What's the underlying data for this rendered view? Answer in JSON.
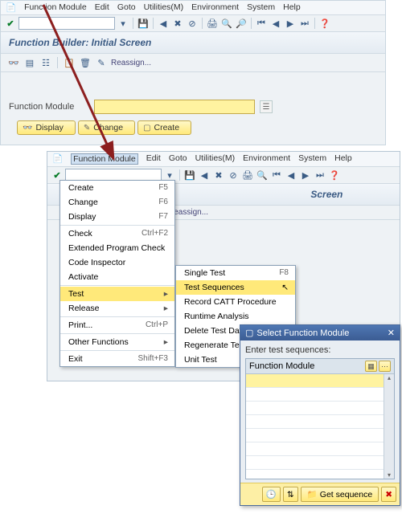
{
  "menus": {
    "m1": "Function Module",
    "m2": "Edit",
    "m3": "Goto",
    "m4": "Utilities(M)",
    "m5": "Environment",
    "m6": "System",
    "m7": "Help"
  },
  "title": "Function Builder: Initial Screen",
  "toolbar2_label": "Reassign...",
  "form": {
    "label": "Function Module"
  },
  "buttons": {
    "display": "Display",
    "change": "Change",
    "create": "Create"
  },
  "secmenu": {
    "create": {
      "label": "Create",
      "sc": "F5"
    },
    "change": {
      "label": "Change",
      "sc": "F6"
    },
    "display": {
      "label": "Display",
      "sc": "F7"
    },
    "check": {
      "label": "Check",
      "sc": "Ctrl+F2"
    },
    "ext": {
      "label": "Extended Program Check"
    },
    "ci": {
      "label": "Code Inspector"
    },
    "activate": {
      "label": "Activate"
    },
    "test": {
      "label": "Test"
    },
    "release": {
      "label": "Release"
    },
    "print": {
      "label": "Print...",
      "sc": "Ctrl+P"
    },
    "other": {
      "label": "Other Functions"
    },
    "exit": {
      "label": "Exit",
      "sc": "Shift+F3"
    }
  },
  "testsub": {
    "single": {
      "label": "Single Test",
      "sc": "F8"
    },
    "seq": {
      "label": "Test Sequences"
    },
    "catt": {
      "label": "Record CATT Procedure"
    },
    "rt": {
      "label": "Runtime Analysis"
    },
    "del": {
      "label": "Delete Test Data"
    },
    "regen": {
      "label": "Regenerate Test Data"
    },
    "unit": {
      "label": "Unit Test"
    }
  },
  "dialog": {
    "title": "Select Function Module",
    "prompt": "Enter test sequences:",
    "col": "Function Module",
    "get": "Get sequence"
  }
}
